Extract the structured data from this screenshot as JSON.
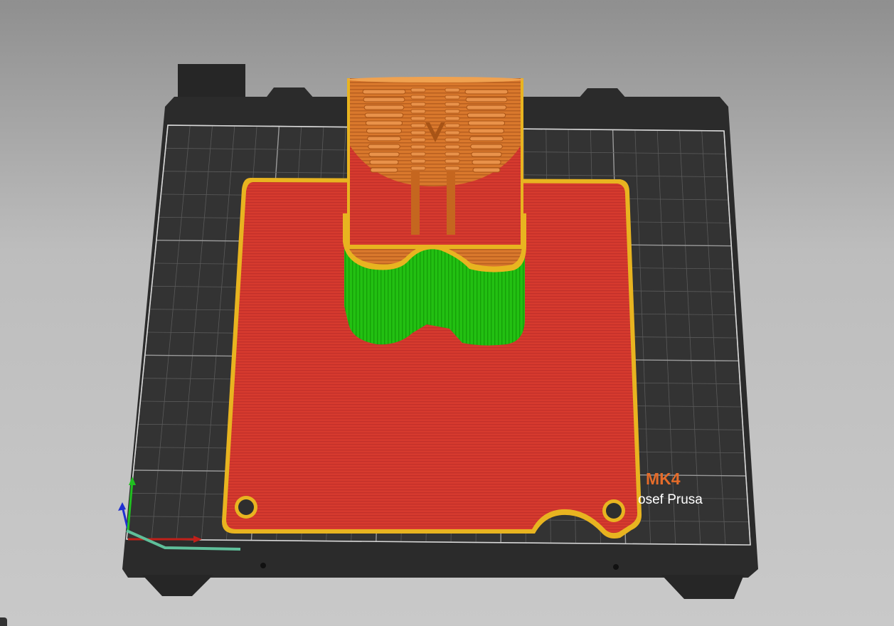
{
  "bed": {
    "model_label": "MK4",
    "brand_label": "osef Prusa"
  },
  "colors": {
    "background_top": "#8f8f8f",
    "background_bottom": "#c9c9c9",
    "bed_frame": "#2b2b2b",
    "bed_surface": "#333333",
    "grid": "#6a6a6a",
    "first_layer_fill": "#d63a2e",
    "perimeter": "#e8b420",
    "object_body": "#d9782c",
    "support": "#22c012",
    "axis_x": "#c0201a",
    "axis_y": "#20c020",
    "axis_z": "#2030d0",
    "brand_orange": "#e56c2a"
  },
  "icons": {
    "axis_gizmo": "xyz-axis-icon"
  }
}
